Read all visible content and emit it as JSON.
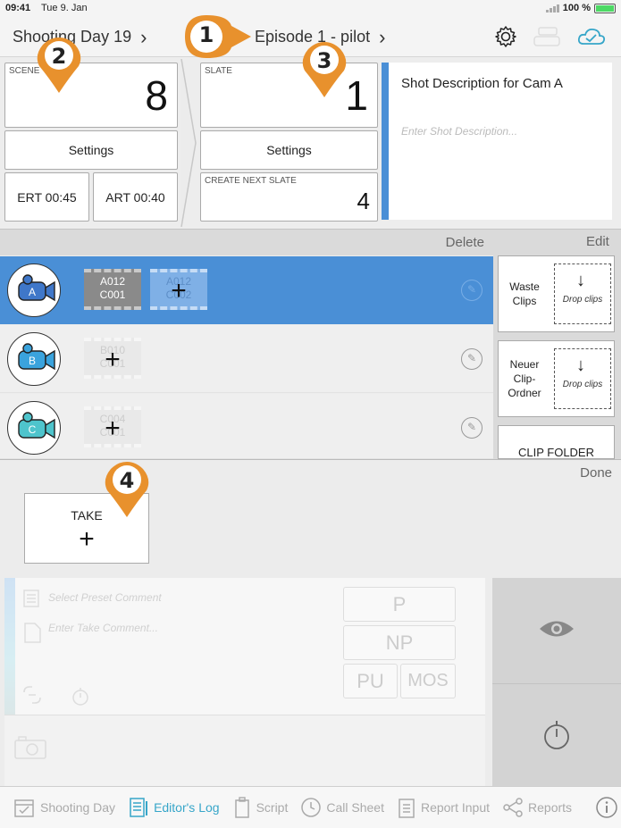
{
  "status": {
    "time": "09:41",
    "date": "Tue 9. Jan",
    "battery": "100 %"
  },
  "nav": {
    "shooting_day": "Shooting Day 19",
    "episode": "Episode 1 - pilot"
  },
  "scene": {
    "label": "SCENE",
    "number": "8",
    "settings": "Settings",
    "ert": "ERT 00:45",
    "art": "ART 00:40"
  },
  "slate": {
    "label": "SLATE",
    "number": "1",
    "settings": "Settings",
    "next_label": "CREATE NEXT SLATE",
    "next_value": "4"
  },
  "shot": {
    "title": "Shot Description for Cam A",
    "placeholder": "Enter Shot Description..."
  },
  "clips": {
    "delete_label": "Delete",
    "edit_label": "Edit",
    "cameras": [
      {
        "letter": "A",
        "clips": [
          {
            "reel": "A012",
            "clip": "C001"
          },
          {
            "reel": "A012",
            "clip": "C002"
          }
        ]
      },
      {
        "letter": "B",
        "clips": [
          {
            "reel": "B010",
            "clip": "C001"
          }
        ]
      },
      {
        "letter": "C",
        "clips": [
          {
            "reel": "C004",
            "clip": "C001"
          }
        ]
      }
    ],
    "waste": "Waste Clips",
    "new_folder": "Neuer Clip-Ordner",
    "drop": "Drop clips",
    "clip_folder": "CLIP FOLDER"
  },
  "take": {
    "done_label": "Done",
    "label": "TAKE",
    "preset_placeholder": "Select Preset Comment",
    "comment_placeholder": "Enter Take Comment...",
    "flags": {
      "p": "P",
      "np": "NP",
      "pu": "PU",
      "mos": "MOS"
    }
  },
  "tabs": [
    {
      "label": "Shooting Day"
    },
    {
      "label": "Editor's Log"
    },
    {
      "label": "Script"
    },
    {
      "label": "Call Sheet"
    },
    {
      "label": "Report Input"
    },
    {
      "label": "Reports"
    }
  ],
  "annotations": {
    "pin1": "1",
    "pin2": "2",
    "pin3": "3",
    "pin4": "4"
  },
  "colors": {
    "accent": "#4a8fd6",
    "pin": "#e8912d",
    "active_tab": "#37a6c9",
    "cam_blue": "#3aa3dd",
    "cam_teal": "#4ec4cc"
  }
}
